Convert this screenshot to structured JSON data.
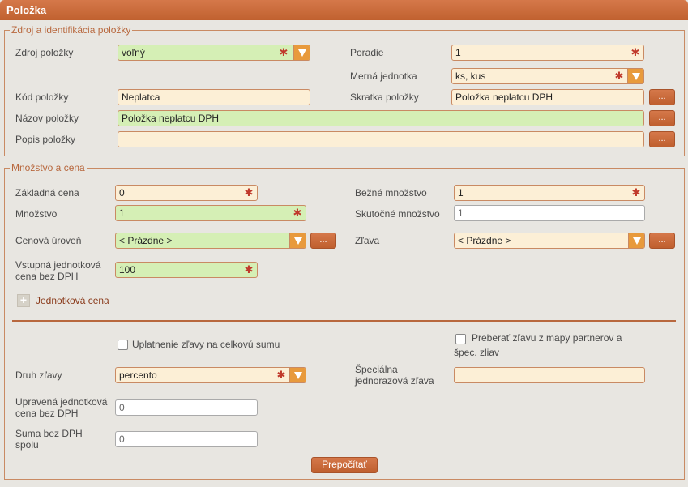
{
  "window": {
    "title": "Položka"
  },
  "section1": {
    "legend": "Zdroj a identifikácia položky",
    "zdroj_label": "Zdroj položky",
    "zdroj_value": "voľný",
    "poradie_label": "Poradie",
    "poradie_value": "1",
    "merna_label": "Merná jednotka",
    "merna_value": "ks, kus",
    "kod_label": "Kód položky",
    "kod_value": "Neplatca",
    "skratka_label": "Skratka položky",
    "skratka_value": "Položka neplatcu DPH",
    "nazov_label": "Názov položky",
    "nazov_value": "Položka neplatcu DPH",
    "popis_label": "Popis položky",
    "popis_value": "",
    "browse_label": "..."
  },
  "section2": {
    "legend": "Množstvo a cena",
    "zakladna_label": "Základná cena",
    "zakladna_value": "0",
    "bezne_label": "Bežné množstvo",
    "bezne_value": "1",
    "mnozstvo_label": "Množstvo",
    "mnozstvo_value": "1",
    "skutocne_label": "Skutočné množstvo",
    "skutocne_value": "1",
    "cenova_label": "Cenová úroveň",
    "cenova_value": "< Prázdne >",
    "zlava_label": "Zľava",
    "zlava_value": "< Prázdne >",
    "vstupna_label_1": "Vstupná jednotková",
    "vstupna_label_2": "cena bez DPH",
    "vstupna_value": "100",
    "jednotkova_link": "Jednotková cena",
    "uplatnenie_label": "Uplatnenie zľavy na celkovú sumu",
    "preberat_label_1": "Preberať zľavu z mapy partnerov a",
    "preberat_label_2": "špec. zliav",
    "druh_label": "Druh zľavy",
    "druh_value": "percento",
    "specialna_label_1": "Špeciálna",
    "specialna_label_2": "jednorazová zľava",
    "specialna_value": "",
    "upravena_label_1": "Upravená jednotková",
    "upravena_label_2": "cena bez DPH",
    "upravena_value": "0",
    "suma_label_1": "Suma bez DPH",
    "suma_label_2": "spolu",
    "suma_value": "0",
    "prepocitat_label": "Prepočítať",
    "browse_label": "..."
  },
  "colors": {
    "accent": "#c96b3a",
    "required_bg": "#fcefd6",
    "valid_bg": "#d5efb5",
    "required_mark": "#c0392b"
  },
  "icons": {
    "required": "required-asterisk-icon",
    "dropdown": "chevron-down-icon",
    "expand": "plus-icon"
  }
}
